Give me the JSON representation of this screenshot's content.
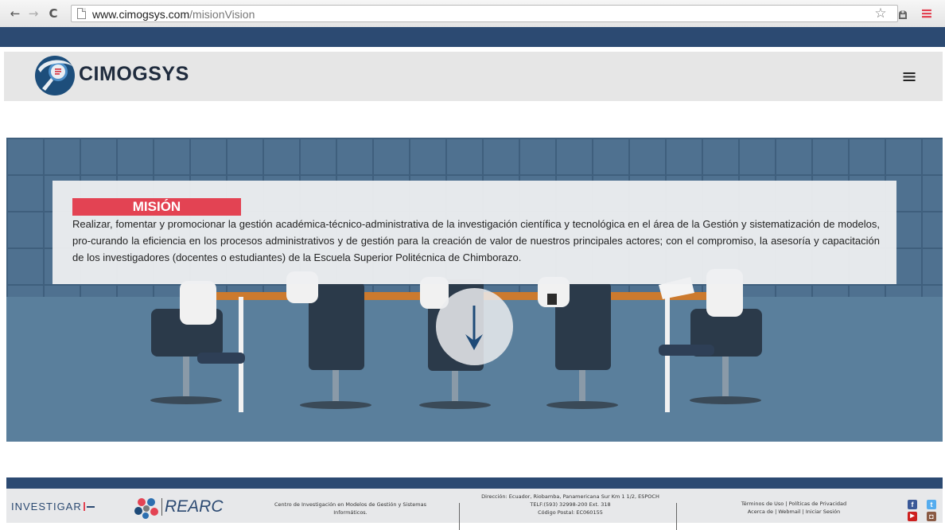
{
  "browser": {
    "back": "←",
    "forward": "→",
    "reload": "C",
    "url_host": "www.cimogsys.com",
    "url_path": "/misionVision",
    "star": "☆",
    "menu": "≡"
  },
  "header": {
    "brand": "CIMOGSYS",
    "hamburger": "≡"
  },
  "mission": {
    "title": "MISIÓN",
    "text": "Realizar, fomentar y promocionar la gestión académica-técnico-administrativa de la investigación científica y tecnológica en el área de la Gestión y sistematización de modelos, pro-curando la eficiencia en los procesos administrativos y de gestión para la creación de valor de nuestros principales actores; con el compromiso, la asesoría y capacitación de los investigadores (docentes o estudiantes) de la Escuela Superior Politécnica de Chimborazo."
  },
  "footer": {
    "investigar": "INVESTIGAR",
    "rearc": "REARC",
    "center_name": [
      "Centro de Investigación en Modelos de Gestión y Sistemas",
      "Informáticos."
    ],
    "address": [
      "Dirección: Ecuador, Riobamba, Panamericana Sur Km 1 1/2, ESPOCH",
      "TELF:(593) 32998-200 Ext. 318",
      "Código Postal: EC060155"
    ],
    "links_row1": [
      "Términos de Uso",
      "Políticas de Privacidad"
    ],
    "links_row2": [
      "Acerca de",
      "Webmail",
      "Iniciar Sesión"
    ],
    "separator": "|",
    "social": {
      "facebook": "f",
      "twitter": "t",
      "youtube": "▶",
      "instagram": "◘"
    }
  },
  "colors": {
    "topbar": "#2c4a72",
    "mission_badge": "#e34353",
    "facebook": "#3b5998",
    "twitter": "#55acee",
    "youtube": "#cd201f",
    "instagram": "#8a5a44"
  }
}
